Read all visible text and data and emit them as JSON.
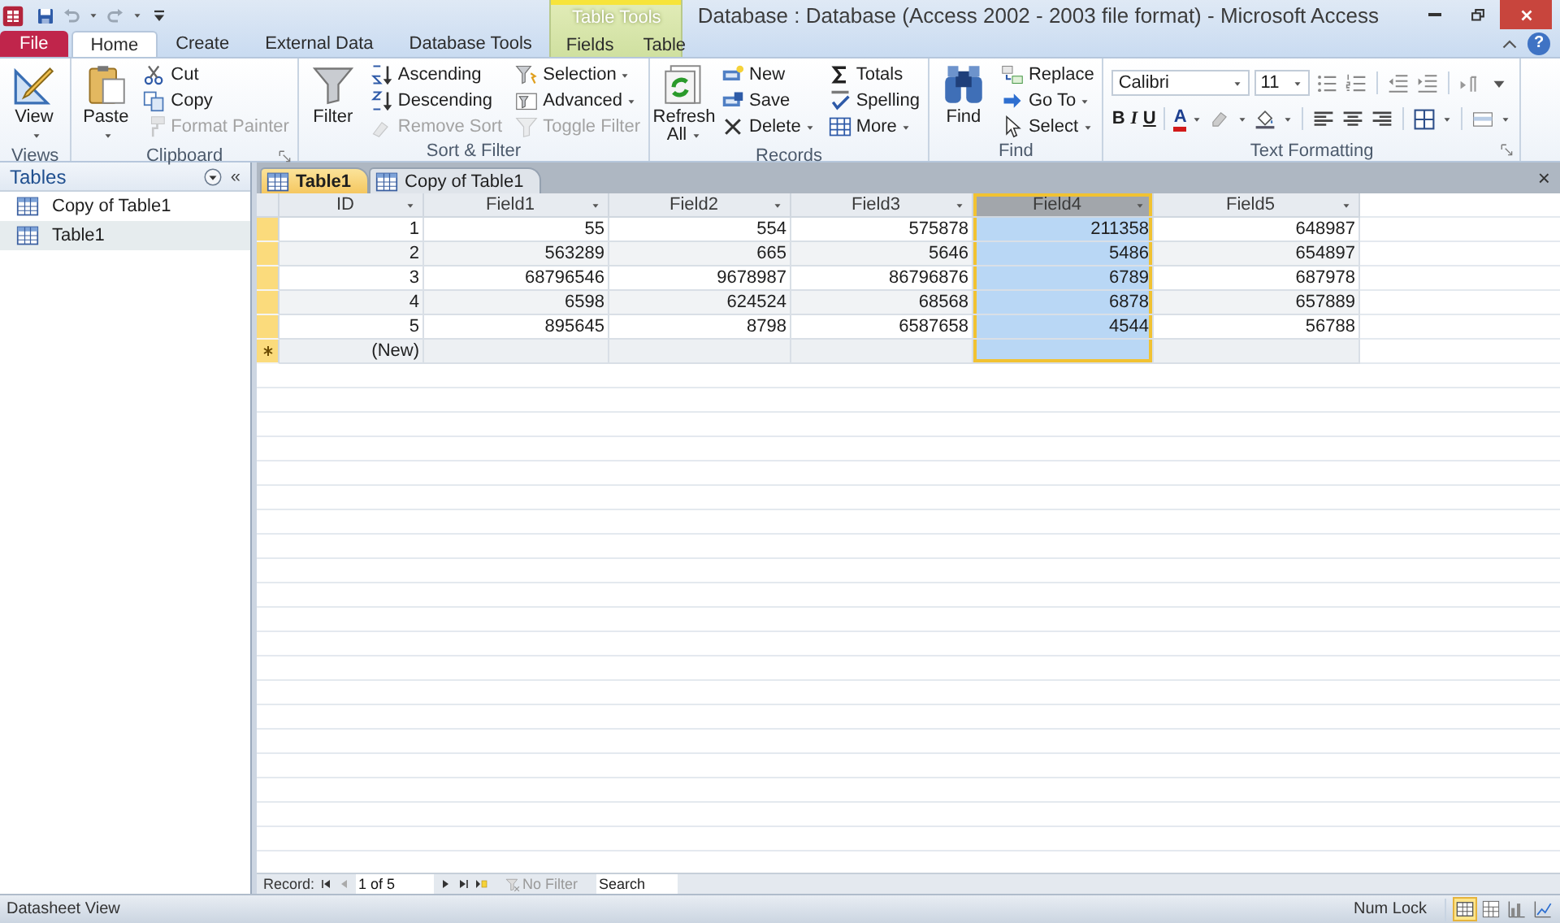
{
  "title_bar": {
    "title": "Database : Database (Access 2002 - 2003 file format)  -  Microsoft Access",
    "contextual_group": "Table Tools",
    "help": "?"
  },
  "ribbon_tabs": [
    {
      "label": "File",
      "kind": "file",
      "selected": false
    },
    {
      "label": "Home",
      "kind": "normal",
      "selected": true
    },
    {
      "label": "Create",
      "kind": "normal",
      "selected": false
    },
    {
      "label": "External Data",
      "kind": "normal",
      "selected": false
    },
    {
      "label": "Database Tools",
      "kind": "normal",
      "selected": false
    },
    {
      "label": "Fields",
      "kind": "contextual",
      "selected": false
    },
    {
      "label": "Table",
      "kind": "contextual",
      "selected": false
    }
  ],
  "ribbon_groups": [
    {
      "label": "Views",
      "kind": "standard",
      "launcher": false,
      "items": [
        {
          "label": "View",
          "kind": "large",
          "dropdown": true,
          "disabled": false
        }
      ]
    },
    {
      "label": "Clipboard",
      "kind": "standard",
      "launcher": true,
      "items": [
        {
          "label": "Paste",
          "kind": "large",
          "dropdown": true,
          "disabled": false
        },
        {
          "label": "Cut",
          "kind": "small",
          "dropdown": false,
          "disabled": false
        },
        {
          "label": "Copy",
          "kind": "small",
          "dropdown": false,
          "disabled": false
        },
        {
          "label": "Format Painter",
          "kind": "small",
          "dropdown": false,
          "disabled": true
        }
      ]
    },
    {
      "label": "Sort & Filter",
      "kind": "standard",
      "launcher": false,
      "items": [
        {
          "label": "Filter",
          "kind": "large",
          "dropdown": false,
          "disabled": false
        },
        {
          "label": "Ascending",
          "kind": "small",
          "dropdown": false,
          "disabled": false
        },
        {
          "label": "Descending",
          "kind": "small",
          "dropdown": false,
          "disabled": false
        },
        {
          "label": "Remove Sort",
          "kind": "small",
          "dropdown": false,
          "disabled": true
        },
        {
          "label": "Selection",
          "kind": "small",
          "dropdown": true,
          "disabled": false
        },
        {
          "label": "Advanced",
          "kind": "small",
          "dropdown": true,
          "disabled": false
        },
        {
          "label": "Toggle Filter",
          "kind": "small",
          "dropdown": false,
          "disabled": true
        }
      ]
    },
    {
      "label": "Records",
      "kind": "standard",
      "launcher": false,
      "items": [
        {
          "label": "Refresh All",
          "kind": "large",
          "dropdown": true,
          "disabled": false
        },
        {
          "label": "New",
          "kind": "small",
          "dropdown": false,
          "disabled": false
        },
        {
          "label": "Save",
          "kind": "small",
          "dropdown": false,
          "disabled": false
        },
        {
          "label": "Delete",
          "kind": "small",
          "dropdown": true,
          "disabled": false
        },
        {
          "label": "Totals",
          "kind": "small",
          "dropdown": false,
          "disabled": false
        },
        {
          "label": "Spelling",
          "kind": "small",
          "dropdown": false,
          "disabled": false
        },
        {
          "label": "More",
          "kind": "small",
          "dropdown": true,
          "disabled": false
        }
      ]
    },
    {
      "label": "Find",
      "kind": "standard",
      "launcher": false,
      "items": [
        {
          "label": "Find",
          "kind": "large",
          "dropdown": false,
          "disabled": false
        },
        {
          "label": "Replace",
          "kind": "small",
          "dropdown": false,
          "disabled": false
        },
        {
          "label": "Go To",
          "kind": "small",
          "dropdown": true,
          "disabled": false
        },
        {
          "label": "Select",
          "kind": "small",
          "dropdown": true,
          "disabled": false
        }
      ]
    },
    {
      "label": "Text Formatting",
      "kind": "formatting",
      "launcher": true,
      "font": "Calibri",
      "size": "11",
      "styles": [
        "B",
        "I",
        "U"
      ],
      "font_color": "A"
    }
  ],
  "nav_pane": {
    "title": "Tables",
    "collapse": "«",
    "items": [
      {
        "label": "Copy of Table1",
        "selected": false
      },
      {
        "label": "Table1",
        "selected": true
      }
    ]
  },
  "doc_tabs": {
    "close": "×",
    "tabs": [
      {
        "label": "Table1",
        "selected": true
      },
      {
        "label": "Copy of Table1",
        "selected": false
      }
    ]
  },
  "datasheet": {
    "columns": [
      {
        "label": "ID",
        "selected": false
      },
      {
        "label": "Field1",
        "selected": false
      },
      {
        "label": "Field2",
        "selected": false
      },
      {
        "label": "Field3",
        "selected": false
      },
      {
        "label": "Field4",
        "selected": true
      },
      {
        "label": "Field5",
        "selected": false
      }
    ],
    "rows": [
      [
        "1",
        "55",
        "554",
        "575878",
        "211358",
        "648987"
      ],
      [
        "2",
        "563289",
        "665",
        "5646",
        "5486",
        "654897"
      ],
      [
        "3",
        "68796546",
        "9678987",
        "86796876",
        "6789",
        "687978"
      ],
      [
        "4",
        "6598",
        "624524",
        "68568",
        "6878",
        "657889"
      ],
      [
        "5",
        "895645",
        "8798",
        "6587658",
        "4544",
        "56788"
      ]
    ],
    "new_row": "(New)"
  },
  "record_nav": {
    "label": "Record:",
    "position": "1 of 5",
    "filter": "No Filter",
    "search_placeholder": "Search"
  },
  "status_bar": {
    "view": "Datasheet View",
    "indicators": [
      "Num Lock"
    ],
    "view_buttons": [
      {
        "selected": true
      },
      {
        "selected": false
      },
      {
        "selected": false
      },
      {
        "selected": false
      }
    ]
  }
}
